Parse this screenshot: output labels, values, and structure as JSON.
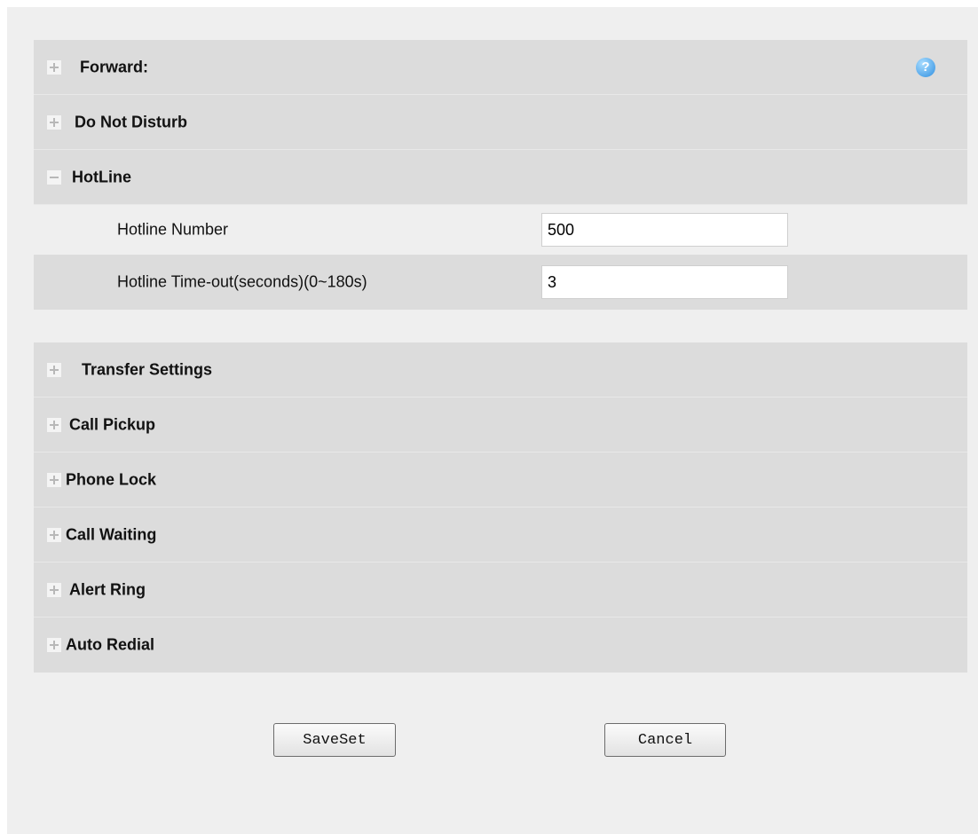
{
  "sections_top": [
    {
      "label": "Forward:",
      "state": "collapsed",
      "help": true
    },
    {
      "label": "Do Not Disturb",
      "state": "collapsed"
    },
    {
      "label": "HotLine",
      "state": "expanded"
    }
  ],
  "hotline": {
    "number_label": "Hotline Number",
    "number_value": "500",
    "timeout_label": "Hotline Time-out(seconds)(0~180s)",
    "timeout_value": "3"
  },
  "sections_bottom": [
    {
      "label": "Transfer Settings",
      "state": "collapsed"
    },
    {
      "label": "Call Pickup",
      "state": "collapsed"
    },
    {
      "label": "Phone Lock",
      "state": "collapsed"
    },
    {
      "label": "Call Waiting",
      "state": "collapsed"
    },
    {
      "label": "Alert Ring",
      "state": "collapsed"
    },
    {
      "label": "Auto Redial",
      "state": "collapsed"
    }
  ],
  "help_icon": {
    "glyph": "?",
    "name": "help-icon"
  },
  "buttons": {
    "save": "SaveSet",
    "cancel": "Cancel"
  },
  "colors": {
    "panel": "#dcdcdc",
    "page_background": "#efefef",
    "help_icon": "#2f8fe0"
  }
}
